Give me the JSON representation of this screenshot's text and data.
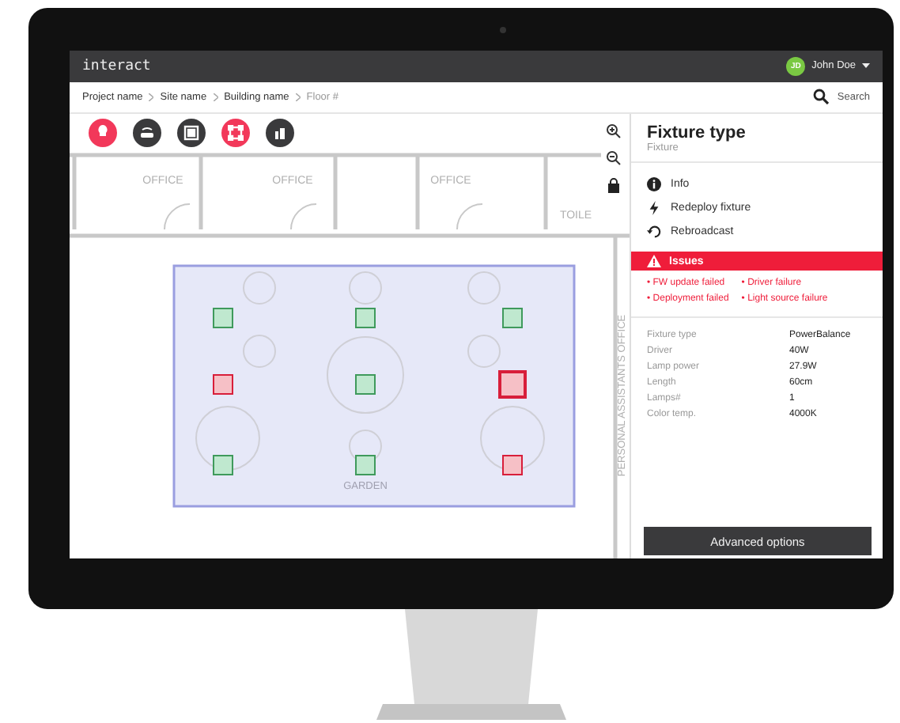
{
  "app": {
    "logo": "interact",
    "user": {
      "initials": "JD",
      "name": "John Doe"
    }
  },
  "breadcrumb": {
    "items": [
      {
        "label": "Project name",
        "current": false
      },
      {
        "label": "Site name",
        "current": false
      },
      {
        "label": "Building name",
        "current": false
      },
      {
        "label": "Floor #",
        "current": true
      }
    ],
    "search": "Search"
  },
  "toolbar": [
    {
      "selected": true
    },
    {
      "selected": false
    },
    {
      "selected": false
    },
    {
      "selected": true
    },
    {
      "selected": false
    }
  ],
  "map": {
    "rooms": [
      "OFFICE",
      "OFFICE",
      "OFFICE",
      "TOILE"
    ],
    "side_room": "PERSONAL ASSISTANTS OFFICE",
    "zone": "GARDEN",
    "fixtures": [
      {
        "failed": false,
        "selected": false
      },
      {
        "failed": false,
        "selected": false
      },
      {
        "failed": false,
        "selected": false
      },
      {
        "failed": true,
        "selected": false
      },
      {
        "failed": false,
        "selected": false
      },
      {
        "failed": true,
        "selected": true
      },
      {
        "failed": false,
        "selected": false
      },
      {
        "failed": false,
        "selected": false
      },
      {
        "failed": true,
        "selected": false
      }
    ]
  },
  "panel": {
    "title": "Fixture type",
    "subtitle": "Fixture",
    "actions": [
      {
        "kind": "info",
        "label": "Info"
      },
      {
        "kind": "bolt",
        "label": "Redeploy fixture"
      },
      {
        "kind": "refresh",
        "label": "Rebroadcast"
      }
    ],
    "issues": {
      "title": "Issues",
      "items": [
        "• FW update failed",
        "• Driver failure",
        "• Deployment failed",
        "• Light source failure"
      ]
    },
    "properties": [
      {
        "name": "Fixture type",
        "value": "PowerBalance"
      },
      {
        "name": "Driver",
        "value": "40W"
      },
      {
        "name": "Lamp power",
        "value": "27.9W"
      },
      {
        "name": "Length",
        "value": "60cm"
      },
      {
        "name": "Lamps#",
        "value": "1"
      },
      {
        "name": "Color temp.",
        "value": "4000K"
      }
    ],
    "button": "Advanced options"
  }
}
